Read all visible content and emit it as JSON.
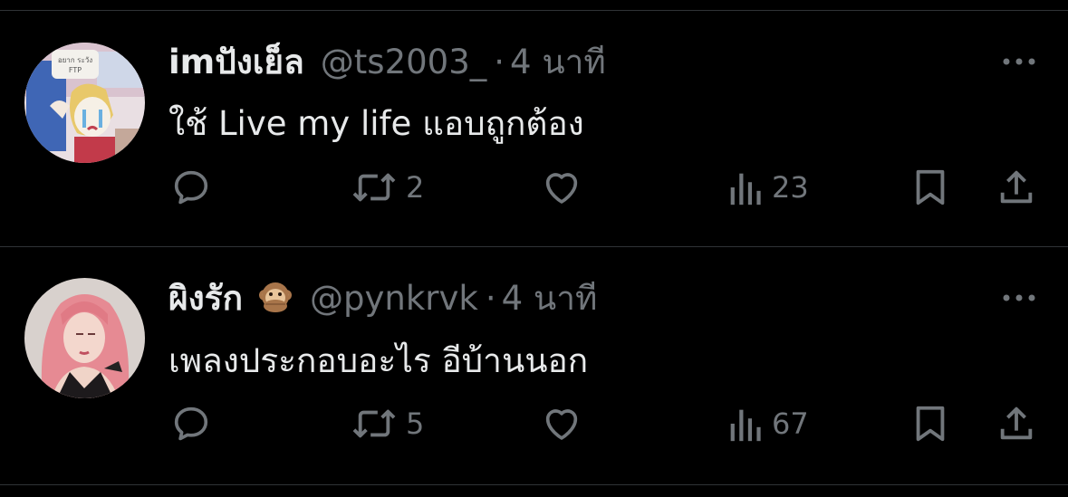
{
  "theme": {
    "background": "#000000",
    "primary_text": "#e7e9ea",
    "secondary_text": "#71767b",
    "divider": "#2f3336"
  },
  "tweets": [
    {
      "display_name": "imปังเย็ล",
      "handle": "@ts2003_",
      "separator": "·",
      "time": "4 นาที",
      "text": "ใช้ Live my life แอบถูกต้อง",
      "avatar_icon": "avatar-cartoon-crying-girl",
      "retweets": "2",
      "views": "23"
    },
    {
      "display_name": "ผิงรัก",
      "name_emoji": "speak-no-evil-monkey-emoji",
      "handle": "@pynkrvk",
      "separator": "·",
      "time": "4 นาที",
      "text": "เพลงประกอบอะไร อีบ้านนอก",
      "avatar_icon": "avatar-pink-hair-woman",
      "retweets": "5",
      "views": "67"
    }
  ]
}
